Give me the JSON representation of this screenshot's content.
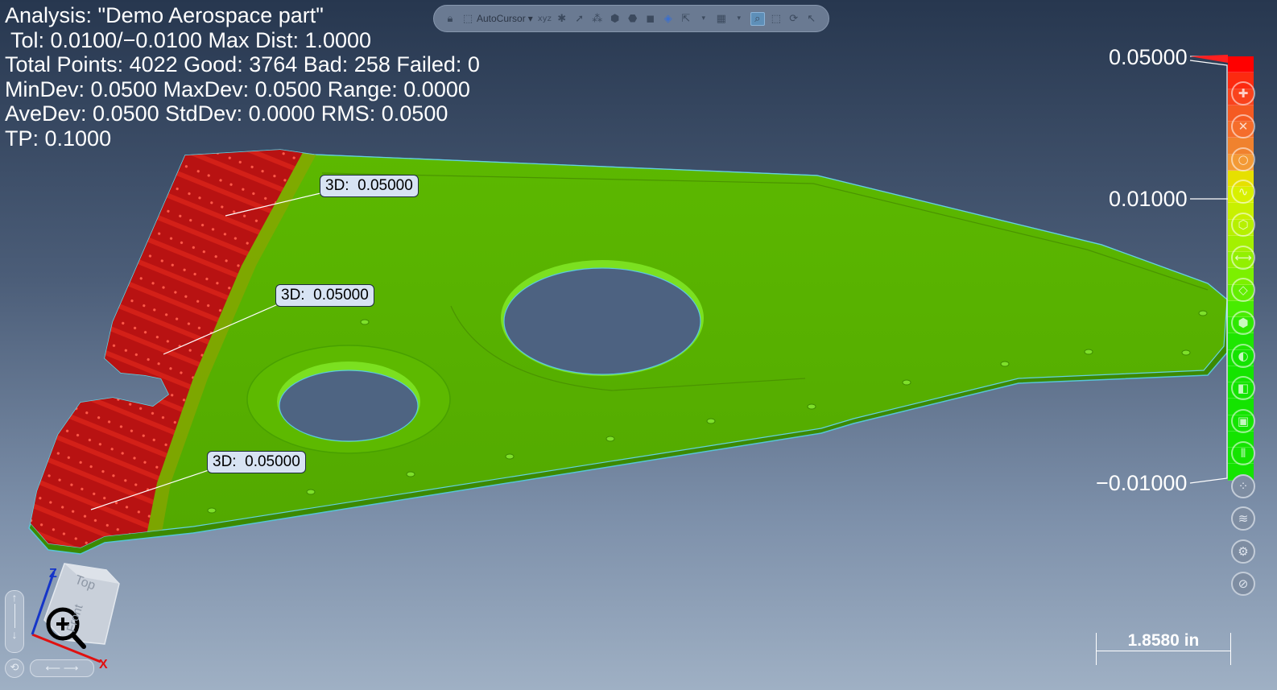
{
  "analysis": {
    "line1": "Analysis: \"Demo Aerospace part\"",
    "line2": " Tol: 0.0100/−0.0100 Max Dist: 1.0000",
    "line3": "Total Points: 4022 Good: 3764 Bad: 258 Failed: 0",
    "line4": "MinDev: 0.0500 MaxDev: 0.0500 Range: 0.0000",
    "line5": "AveDev: 0.0500 StdDev: 0.0000 RMS: 0.0500",
    "line6": "TP: 0.1000"
  },
  "toolbar": {
    "autocursor_label": "AutoCursor",
    "xyz_label": "xyz"
  },
  "callouts": [
    "3D:  0.05000",
    "3D:  0.05000",
    "3D:  0.05000"
  ],
  "color_scale": {
    "top": "0.05000",
    "mid": "0.01000",
    "bottom": "−0.01000",
    "colors": [
      "#ff0000",
      "#fc2a10",
      "#f9431c",
      "#f55a22",
      "#f56d2b",
      "#f0822e",
      "#f39a36",
      "#e6e000",
      "#d8f000",
      "#c8f000",
      "#b6f000",
      "#a4f000",
      "#92f000",
      "#7cf000",
      "#63ee00",
      "#48ec00",
      "#2ee800",
      "#1ee600",
      "#14e400",
      "#14e400",
      "#14e400",
      "#14e400",
      "#14e400",
      "#14e400",
      "#14e400",
      "#14e400"
    ]
  },
  "ruler": {
    "label": "1.8580 in"
  },
  "view_cube": {
    "face_top": "Top",
    "face_front": "Front",
    "axis_x": "X",
    "axis_z": "Z"
  },
  "colors": {
    "good": "#5ab400",
    "bad": "#c01010"
  },
  "icons": {
    "side_tools": [
      "plus-icon",
      "cross-icon",
      "circle-icon",
      "curve-icon",
      "cube-icon",
      "dimension-icon",
      "tag-icon",
      "box-icon",
      "cylinder-icon",
      "layer-icon",
      "square-icon",
      "align-icon",
      "grid-icon",
      "layers-icon",
      "settings-icon",
      "no-entry-icon"
    ]
  }
}
